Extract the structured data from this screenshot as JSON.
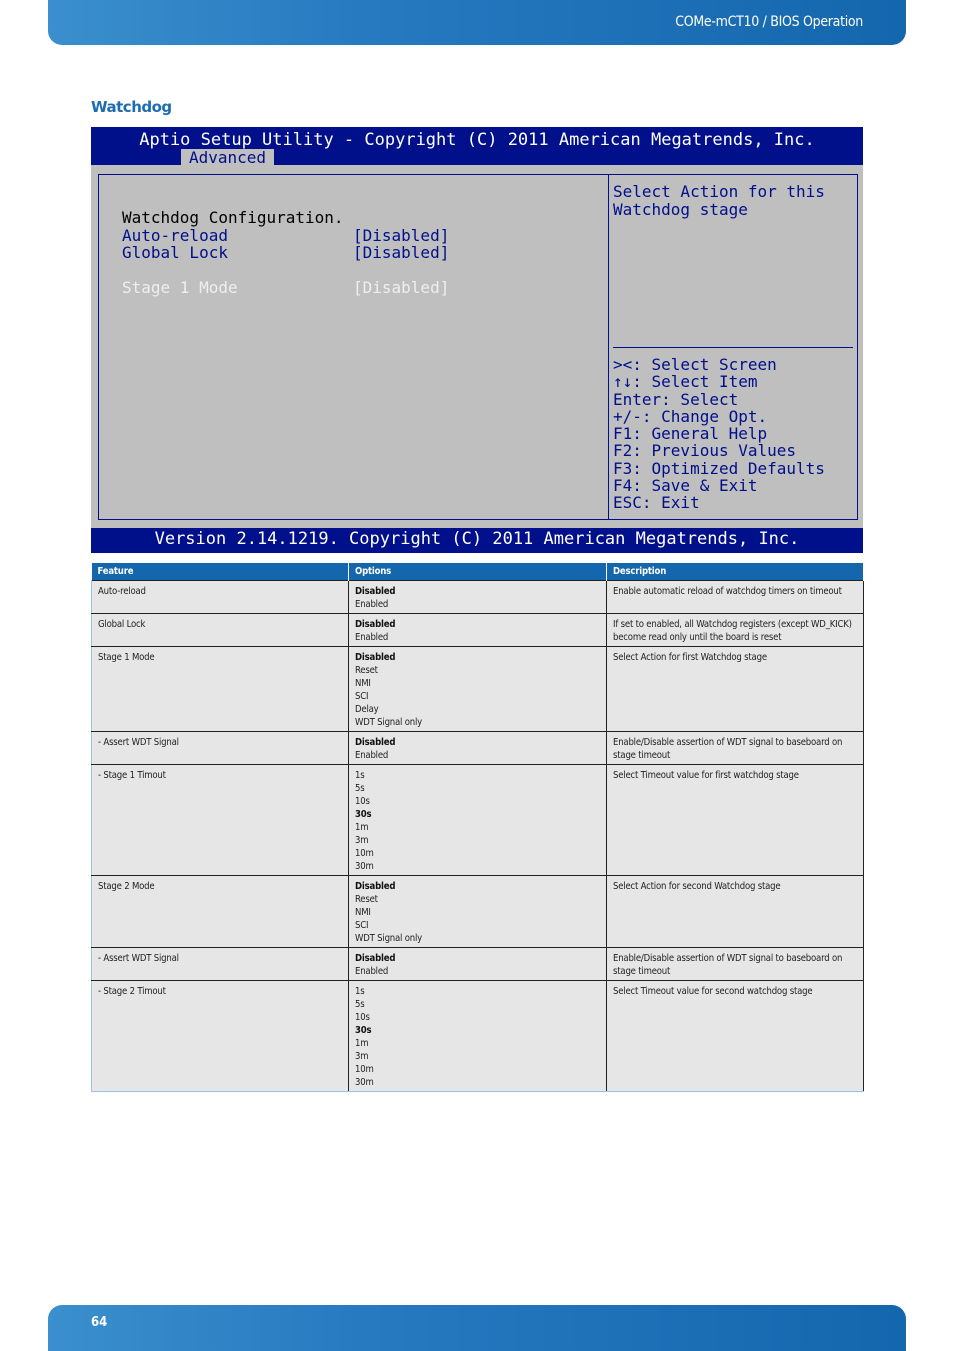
{
  "header": {
    "title": "COMe-mCT10 / BIOS Operation"
  },
  "section": {
    "title": "Watchdog"
  },
  "bios": {
    "title": "Aptio Setup Utility - Copyright (C) 2011 American Megatrends, Inc.",
    "active_tab": "Advanced",
    "heading": "Watchdog Configuration.",
    "items": [
      {
        "label": "Auto-reload",
        "value": "[Disabled]",
        "state": "normal"
      },
      {
        "label": "Global Lock",
        "value": "[Disabled]",
        "state": "normal"
      },
      {
        "label": "Stage 1 Mode",
        "value": "[Disabled]",
        "state": "selected"
      }
    ],
    "help_text": "Select Action for this Watchdog stage",
    "keys": [
      "><: Select Screen",
      "↑↓: Select Item",
      "Enter: Select",
      "+/-: Change Opt.",
      "F1: General Help",
      "F2: Previous Values",
      "F3: Optimized Defaults",
      "F4: Save & Exit",
      "ESC: Exit"
    ],
    "footer": "Version 2.14.1219. Copyright (C) 2011 American Megatrends, Inc."
  },
  "table": {
    "headers": [
      "Feature",
      "Options",
      "Description"
    ],
    "rows": [
      {
        "feature": "Auto-reload",
        "options": [
          "Disabled",
          "Enabled"
        ],
        "default": "Disabled",
        "description": "Enable automatic reload of watchdog timers on timeout"
      },
      {
        "feature": "Global Lock",
        "options": [
          "Disabled",
          "Enabled"
        ],
        "default": "Disabled",
        "description": "If set to enabled, all Watchdog registers (except WD_KICK) become read only until the board is reset"
      },
      {
        "feature": "Stage 1 Mode",
        "options": [
          "Disabled",
          "Reset",
          "NMI",
          "SCI",
          "Delay",
          "WDT Signal only"
        ],
        "default": "Disabled",
        "description": "Select Action for first Watchdog stage"
      },
      {
        "feature": "- Assert WDT Signal",
        "options": [
          "Disabled",
          "Enabled"
        ],
        "default": "Disabled",
        "description": "Enable/Disable assertion of WDT signal to baseboard on stage timeout"
      },
      {
        "feature": "- Stage 1 Timout",
        "options": [
          "1s",
          "5s",
          "10s",
          "30s",
          "1m",
          "3m",
          "10m",
          "30m"
        ],
        "default": "30s",
        "description": "Select Timeout value for first watchdog stage"
      },
      {
        "feature": "Stage 2 Mode",
        "options": [
          "Disabled",
          "Reset",
          "NMI",
          "SCI",
          "WDT Signal only"
        ],
        "default": "Disabled",
        "description": "Select Action for second Watchdog stage"
      },
      {
        "feature": "- Assert WDT Signal",
        "options": [
          "Disabled",
          "Enabled"
        ],
        "default": "Disabled",
        "description": "Enable/Disable assertion of WDT signal to baseboard on stage timeout"
      },
      {
        "feature": "- Stage 2 Timout",
        "options": [
          "1s",
          "5s",
          "10s",
          "30s",
          "1m",
          "3m",
          "10m",
          "30m"
        ],
        "default": "30s",
        "description": "Select Timeout value for second watchdog stage"
      }
    ]
  },
  "footer": {
    "page_number": "64"
  }
}
